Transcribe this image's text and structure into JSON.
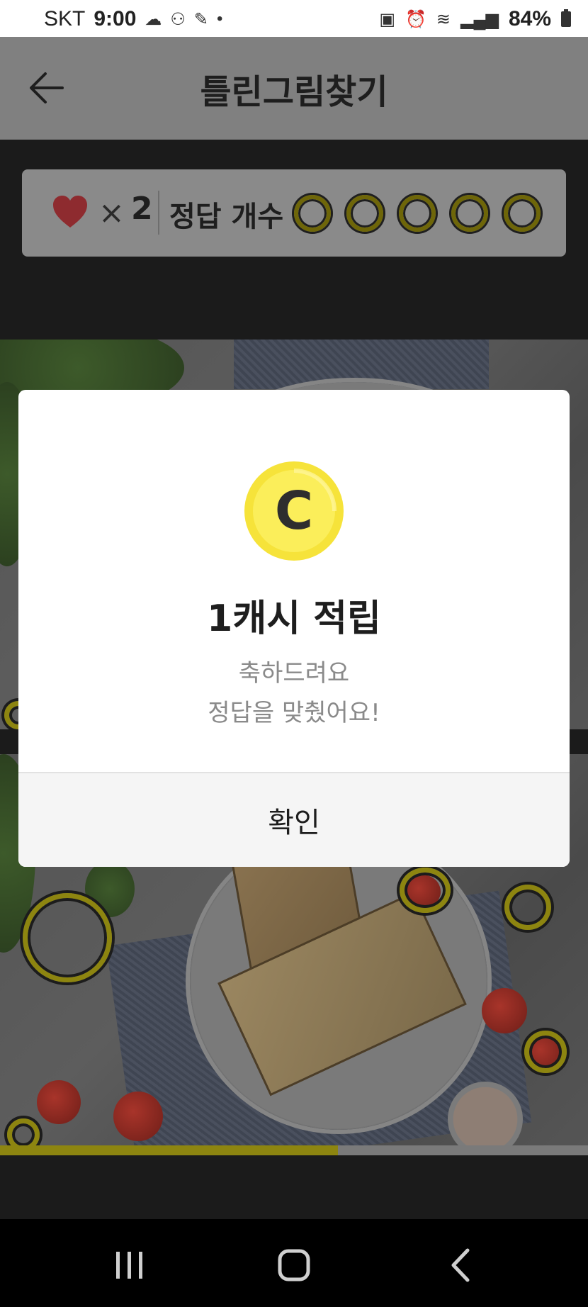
{
  "status_bar": {
    "carrier": "SKT",
    "time": "9:00",
    "battery": "84%"
  },
  "header": {
    "title": "틀린그림찾기"
  },
  "score": {
    "lives_symbol": "×",
    "lives_count": "2",
    "answers_label": "정답 개수",
    "answers_found": 0,
    "answers_total": 5
  },
  "progress": {
    "fraction": 0.575
  },
  "dialog": {
    "coin_letter": "C",
    "title": "1캐시 적립",
    "line1": "축하드려요",
    "line2": "정답을 맞췄어요!",
    "confirm_label": "확인"
  },
  "colors": {
    "coin_yellow": "#f7e94a",
    "ring_yellow": "#e6d81a",
    "heart_red": "#d9363e"
  },
  "icons": {
    "back": "arrow-left-icon",
    "heart": "heart-icon",
    "coin": "cash-coin-icon",
    "nav_recent": "recent-apps-icon",
    "nav_home": "home-icon",
    "nav_back": "chevron-left-icon"
  }
}
